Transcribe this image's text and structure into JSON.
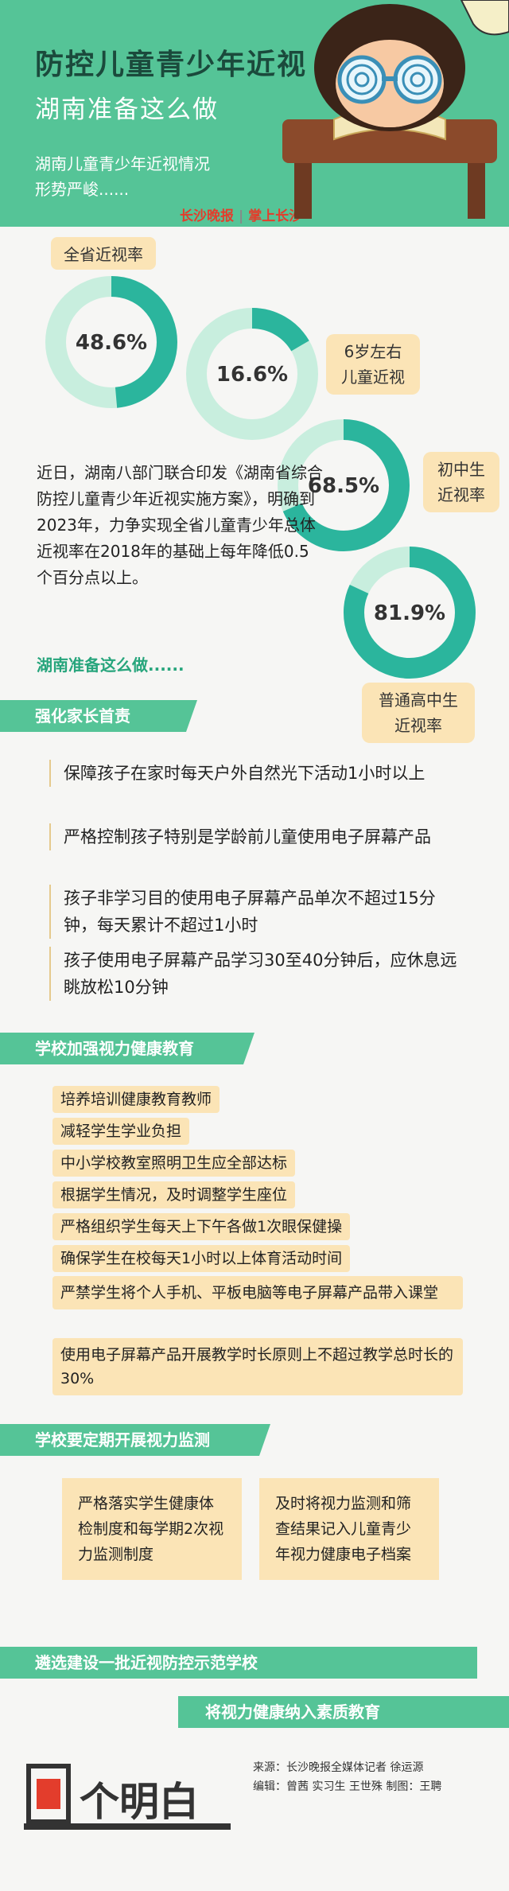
{
  "header": {
    "title": "防控儿童青少年近视",
    "subtitle": "湖南准备这么做",
    "desc_line1": "湖南儿童青少年近视情况",
    "desc_line2": "形势严峻......",
    "brand_left": "长沙晚报",
    "brand_right": "掌上长沙"
  },
  "stats": {
    "overall_label": "全省近视率",
    "items": [
      {
        "value": "48.6%",
        "fraction": 0.486,
        "label": ""
      },
      {
        "value": "16.6%",
        "fraction": 0.166,
        "label_1": "6岁左右",
        "label_2": "儿童近视"
      },
      {
        "value": "68.5%",
        "fraction": 0.685,
        "label_1": "初中生",
        "label_2": "近视率"
      },
      {
        "value": "81.9%",
        "fraction": 0.819,
        "label_1": "普通高中生",
        "label_2": "近视率"
      }
    ]
  },
  "intro": {
    "text": "近日，湖南八部门联合印发《湖南省综合防控儿童青少年近视实施方案》，明确到2023年，力争实现全省儿童青少年总体近视率在2018年的基础上每年降低0.5个百分点以上。"
  },
  "prep_label": "湖南准备这么做......",
  "section1": {
    "title": "强化家长首责",
    "items": [
      "保障孩子在家时每天户外自然光下活动1小时以上",
      "严格控制孩子特别是学龄前儿童使用电子屏幕产品",
      "孩子非学习目的使用电子屏幕产品单次不超过15分钟，每天累计不超过1小时",
      "孩子使用电子屏幕产品学习30至40分钟后，应休息远眺放松10分钟"
    ]
  },
  "section2": {
    "title": "学校加强视力健康教育",
    "items": [
      "培养培训健康教育教师",
      "减轻学生学业负担",
      "中小学校教室照明卫生应全部达标",
      "根据学生情况，及时调整学生座位",
      "严格组织学生每天上下午各做1次眼保健操",
      "确保学生在校每天1小时以上体育活动时间",
      "严禁学生将个人手机、平板电脑等电子屏幕产品带入课堂",
      "使用电子屏幕产品开展教学时长原则上不超过教学总时长的30%"
    ]
  },
  "section3": {
    "title": "学校要定期开展视力监测",
    "box_left": "严格落实学生健康体检制度和每学期2次视力监测制度",
    "box_right": "及时将视力监测和筛查结果记入儿童青少年视力健康电子档案"
  },
  "band1": "遴选建设一批近视防控示范学校",
  "band2": "将视力健康纳入素质教育",
  "footer": {
    "logo_text": "个明白",
    "source": "来源：长沙晚报全媒体记者 徐运源",
    "editors": "编辑：曾茜 实习生 王世殊   制图：王聘"
  },
  "colors": {
    "green": "#55c497",
    "ring_light": "#c8eede",
    "ring_dark": "#2bb59d",
    "callout": "#fbe4b6"
  }
}
